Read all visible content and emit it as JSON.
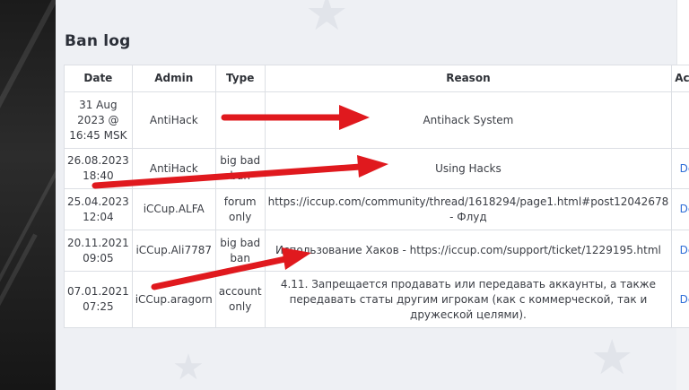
{
  "page": {
    "title": "Ban log"
  },
  "table": {
    "headers": [
      "Date",
      "Admin",
      "Type",
      "Reason",
      "Actions"
    ],
    "rows": [
      {
        "date": "31 Aug 2023 @ 16:45 MSK",
        "admin": "AntiHack",
        "type": "",
        "reason": "Antihack System",
        "action": ""
      },
      {
        "date": "26.08.2023 18:40",
        "admin": "AntiHack",
        "type": "big bad ban",
        "reason": "Using Hacks",
        "action": "Delete"
      },
      {
        "date": "25.04.2023 12:04",
        "admin": "iCCup.ALFA",
        "type": "forum only",
        "reason": "https://iccup.com/community/thread/1618294/page1.html#post12042678 - Флуд",
        "action": "Delete"
      },
      {
        "date": "20.11.2021 09:05",
        "admin": "iCCup.Ali7787",
        "type": "big bad ban",
        "reason": "Использование Хаков - https://iccup.com/support/ticket/1229195.html",
        "action": "Delete"
      },
      {
        "date": "07.01.2021 07:25",
        "admin": "iCCup.aragorn",
        "type": "account only",
        "reason": "4.11. Запрещается продавать или передавать аккаунты, а также передавать статы другим игрокам (как с коммерческой, так и дружеской целями).",
        "action": "Delete"
      }
    ]
  },
  "colors": {
    "arrow": "#e0191e",
    "link": "#2f6fd8"
  },
  "icons": [
    "star-icon"
  ]
}
